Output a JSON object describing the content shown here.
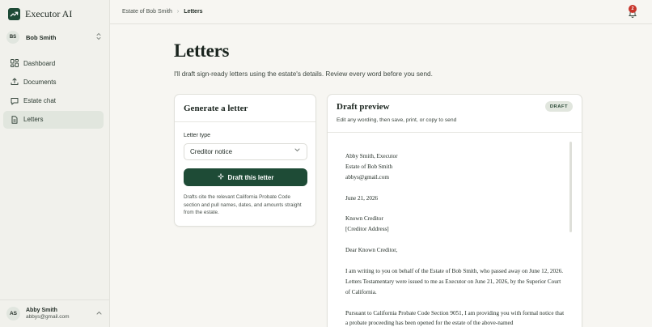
{
  "app": {
    "name": "Executor AI"
  },
  "estate_switcher": {
    "initials": "BS",
    "name": "Bob Smith"
  },
  "nav": [
    {
      "label": "Dashboard",
      "icon": "grid-icon"
    },
    {
      "label": "Documents",
      "icon": "upload-icon"
    },
    {
      "label": "Estate chat",
      "icon": "chat-icon"
    },
    {
      "label": "Letters",
      "icon": "document-icon",
      "active": true
    }
  ],
  "user": {
    "initials": "AS",
    "name": "Abby Smith",
    "email": "abbys@gmail.com"
  },
  "breadcrumb": {
    "parent": "Estate of Bob Smith",
    "current": "Letters"
  },
  "notifications": {
    "count": "2"
  },
  "page": {
    "title": "Letters",
    "subtitle": "I'll draft sign-ready letters using the estate's details. Review every word before you send."
  },
  "generator": {
    "title": "Generate a letter",
    "type_label": "Letter type",
    "type_value": "Creditor notice",
    "button_label": "Draft this letter",
    "note": "Drafts cite the relevant California Probate Code section and pull names, dates, and amounts straight from the estate."
  },
  "preview": {
    "title": "Draft preview",
    "badge": "DRAFT",
    "subtitle": "Edit any wording, then save, print, or copy to send",
    "sender_line1": "Abby Smith, Executor",
    "sender_line2": "Estate of Bob Smith",
    "sender_line3": "abbys@gmail.com",
    "date": "June 21, 2026",
    "recipient_line1": "Known Creditor",
    "recipient_line2": "[Creditor Address]",
    "salutation": "Dear Known Creditor,",
    "para1": "I am writing to you on behalf of the Estate of Bob Smith, who passed away on June 12, 2026. Letters Testamentary were issued to me as Executor on June 21, 2026, by the Superior Court of California.",
    "para2": "Pursuant to California Probate Code Section 9051, I am providing you with formal notice that a probate proceeding has been opened for the estate of the above-named"
  },
  "colors": {
    "brand": "#1e4b36",
    "badge_bg": "#e1e6de",
    "notification": "#c8352b"
  }
}
